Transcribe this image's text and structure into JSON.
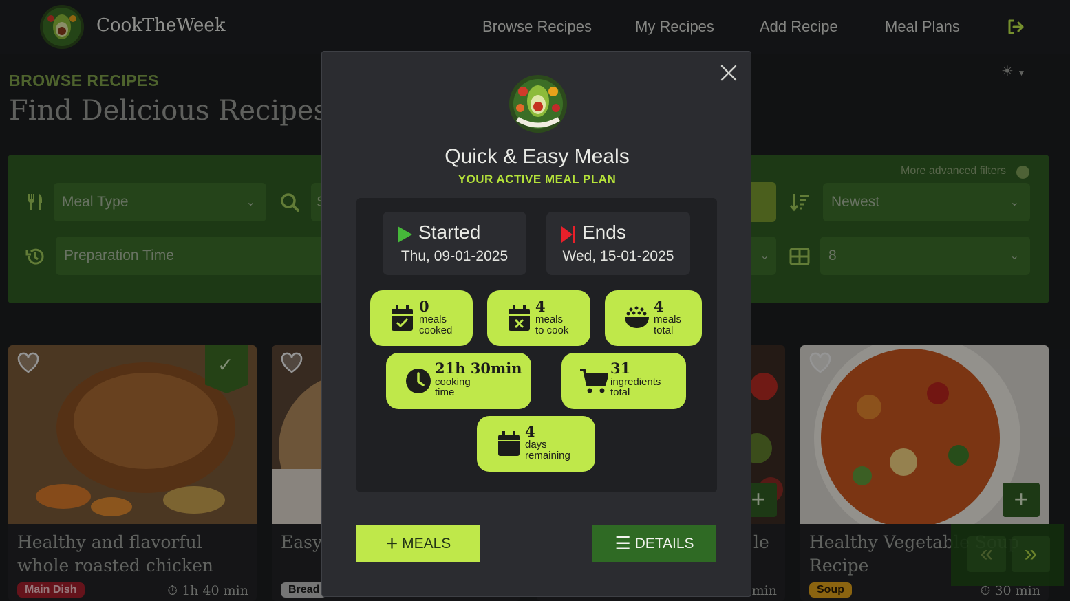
{
  "nav": {
    "brand": "CookTheWeek",
    "links": [
      "Browse Recipes",
      "My Recipes",
      "Add Recipe",
      "Meal Plans"
    ]
  },
  "page": {
    "eyebrow": "BROWSE RECIPES",
    "title": "Find Delicious Recipes T"
  },
  "filters": {
    "meal_type_placeholder": "Meal Type",
    "prep_time_placeholder": "Preparation Time",
    "more_filters": "More advanced filters",
    "sort_value": "Newest",
    "per_page_value": "8",
    "search_partial": "S"
  },
  "cards": [
    {
      "title": "Healthy and flavorful whole roasted chicken",
      "badge": "Main Dish",
      "badge_color": "#c42432",
      "time": "1h 40 min"
    },
    {
      "title": "Easy Recip",
      "badge": "Bread",
      "badge_color": "#bdbdbd",
      "time": ""
    },
    {
      "title": "le",
      "badge": "",
      "badge_color": "#c42432",
      "time": "min"
    },
    {
      "title": "Healthy Vegetable Soup Recipe",
      "badge": "Soup",
      "badge_color": "#e0a21b",
      "time": "30 min"
    }
  ],
  "modal": {
    "title": "Quick & Easy Meals",
    "subtitle": "YOUR ACTIVE MEAL PLAN",
    "started_label": "Started",
    "started_date": "Thu, 09-01-2025",
    "ends_label": "Ends",
    "ends_date": "Wed, 15-01-2025",
    "stats": {
      "cooked": {
        "num": "0",
        "l1": "meals",
        "l2": "cooked"
      },
      "to_cook": {
        "num": "4",
        "l1": "meals",
        "l2": "to cook"
      },
      "total": {
        "num": "4",
        "l1": "meals",
        "l2": "total"
      },
      "cooking_time": {
        "num": "21h 30min",
        "l1": "cooking",
        "l2": "time"
      },
      "ingredients": {
        "num": "31",
        "l1": "ingredients",
        "l2": "total"
      },
      "days": {
        "num": "4",
        "l1": "days",
        "l2": "remaining"
      }
    },
    "meals_button": "MEALS",
    "details_button": "DETAILS"
  },
  "colors": {
    "accent": "#bfe84a",
    "primary": "#2f6a24",
    "danger": "#e8202a"
  }
}
